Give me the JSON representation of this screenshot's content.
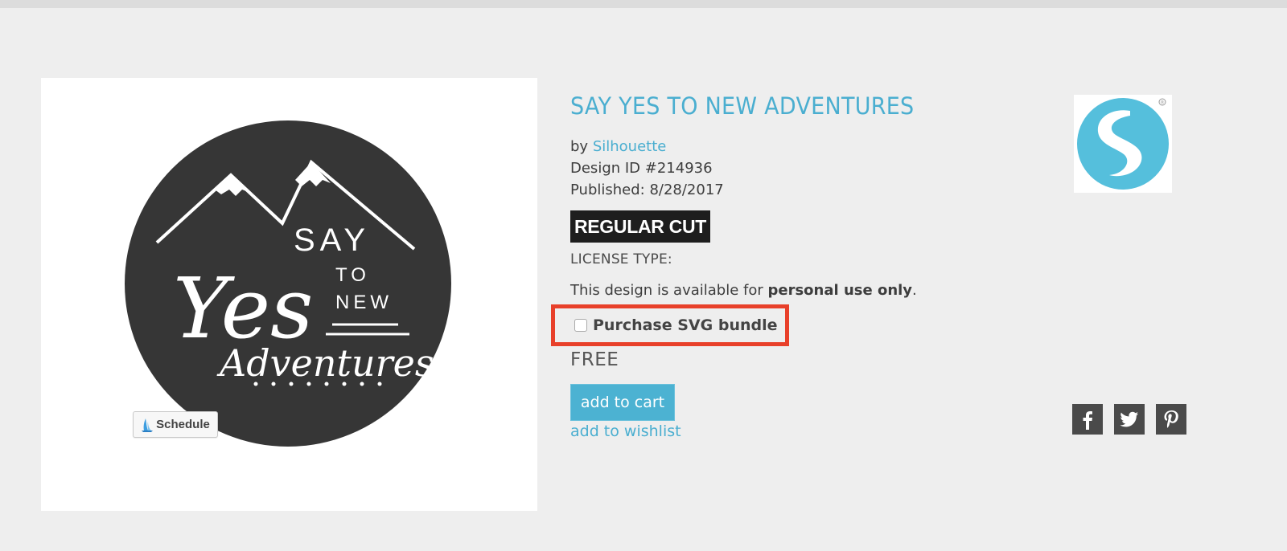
{
  "product": {
    "title": "SAY YES TO NEW ADVENTURES",
    "by_prefix": "by",
    "author": "Silhouette",
    "design_id": "Design ID #214936",
    "published": "Published: 8/28/2017",
    "cut_type_badge": "REGULAR CUT",
    "license_label": "LICENSE TYPE:",
    "license_text_prefix": "This design is available for",
    "license_text_bold": "personal use only",
    "license_text_suffix": ".",
    "svg_bundle_label": "Purchase SVG bundle",
    "svg_bundle_checked": false,
    "price": "FREE",
    "add_to_cart_label": "add to cart",
    "add_to_wishlist_label": "add to wishlist"
  },
  "image_panel": {
    "art_text": {
      "line1": "SAY",
      "line2": "Yes",
      "line3a": "TO",
      "line3b": "NEW",
      "line4": "Adventures"
    },
    "schedule_button_label": "Schedule",
    "schedule_icon": "sailboat-icon"
  },
  "brand_logo": {
    "icon": "silhouette-s-logo",
    "registered_mark": "®"
  },
  "social": [
    {
      "name": "facebook",
      "icon": "facebook-icon"
    },
    {
      "name": "twitter",
      "icon": "twitter-icon"
    },
    {
      "name": "pinterest",
      "icon": "pinterest-icon"
    }
  ],
  "colors": {
    "accent": "#4aaed0",
    "button": "#4cb2d2",
    "highlight_border": "#e8402a",
    "badge_bg": "#1e1e1e",
    "social_bg": "#4a4a4a",
    "page_bg": "#eeeeee"
  }
}
